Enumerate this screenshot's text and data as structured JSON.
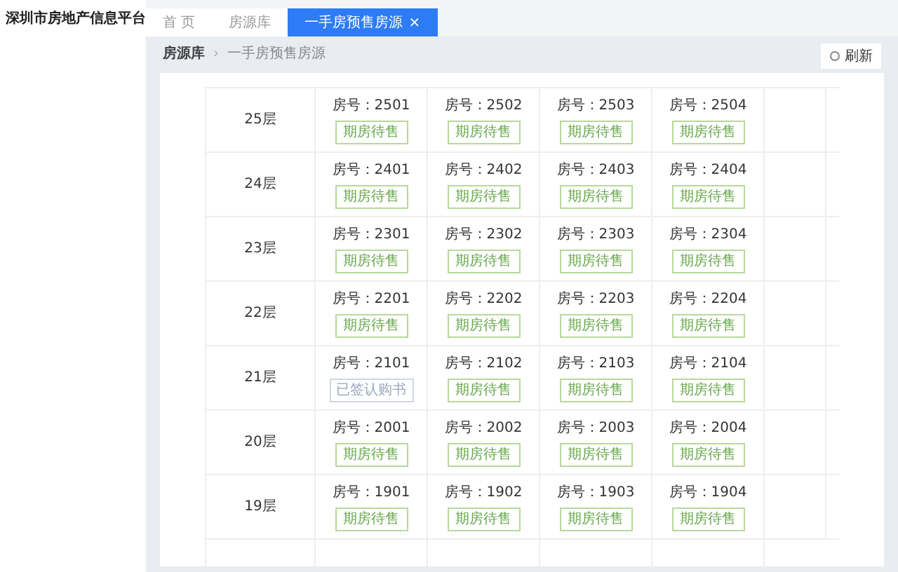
{
  "app_title": "深圳市房地产信息平台",
  "tabs": [
    {
      "label": "首 页",
      "selected": false
    },
    {
      "label": "房源库",
      "selected": false
    },
    {
      "label": "一手房预售房源",
      "selected": true,
      "close": "×"
    }
  ],
  "breadcrumb": [
    {
      "label": "房源库"
    },
    {
      "separator": "›",
      "label": "一手房预售房源"
    }
  ],
  "refresh_button": "刷新",
  "floors": [
    {
      "floor": "25层",
      "units": [
        {
          "room": "房号：2501",
          "status": "期房待售",
          "kind": "available"
        },
        {
          "room": "房号：2502",
          "status": "期房待售",
          "kind": "available"
        },
        {
          "room": "房号：2503",
          "status": "期房待售",
          "kind": "available"
        },
        {
          "room": "房号：2504",
          "status": "期房待售",
          "kind": "available"
        }
      ]
    },
    {
      "floor": "24层",
      "units": [
        {
          "room": "房号：2401",
          "status": "期房待售",
          "kind": "available"
        },
        {
          "room": "房号：2402",
          "status": "期房待售",
          "kind": "available"
        },
        {
          "room": "房号：2403",
          "status": "期房待售",
          "kind": "available"
        },
        {
          "room": "房号：2404",
          "status": "期房待售",
          "kind": "available"
        }
      ]
    },
    {
      "floor": "23层",
      "units": [
        {
          "room": "房号：2301",
          "status": "期房待售",
          "kind": "available"
        },
        {
          "room": "房号：2302",
          "status": "期房待售",
          "kind": "available"
        },
        {
          "room": "房号：2303",
          "status": "期房待售",
          "kind": "available"
        },
        {
          "room": "房号：2304",
          "status": "期房待售",
          "kind": "available"
        }
      ]
    },
    {
      "floor": "22层",
      "units": [
        {
          "room": "房号：2201",
          "status": "期房待售",
          "kind": "available"
        },
        {
          "room": "房号：2202",
          "status": "期房待售",
          "kind": "available"
        },
        {
          "room": "房号：2203",
          "status": "期房待售",
          "kind": "available"
        },
        {
          "room": "房号：2204",
          "status": "期房待售",
          "kind": "available"
        }
      ]
    },
    {
      "floor": "21层",
      "units": [
        {
          "room": "房号：2101",
          "status": "已签认购书",
          "kind": "signed"
        },
        {
          "room": "房号：2102",
          "status": "期房待售",
          "kind": "available"
        },
        {
          "room": "房号：2103",
          "status": "期房待售",
          "kind": "available"
        },
        {
          "room": "房号：2104",
          "status": "期房待售",
          "kind": "available"
        }
      ]
    },
    {
      "floor": "20层",
      "units": [
        {
          "room": "房号：2001",
          "status": "期房待售",
          "kind": "available"
        },
        {
          "room": "房号：2002",
          "status": "期房待售",
          "kind": "available"
        },
        {
          "room": "房号：2003",
          "status": "期房待售",
          "kind": "available"
        },
        {
          "room": "房号：2004",
          "status": "期房待售",
          "kind": "available"
        }
      ]
    },
    {
      "floor": "19层",
      "units": [
        {
          "room": "房号：1901",
          "status": "期房待售",
          "kind": "available"
        },
        {
          "room": "房号：1902",
          "status": "期房待售",
          "kind": "available"
        },
        {
          "room": "房号：1903",
          "status": "期房待售",
          "kind": "available"
        },
        {
          "room": "房号：1904",
          "status": "期房待售",
          "kind": "available"
        }
      ]
    }
  ]
}
